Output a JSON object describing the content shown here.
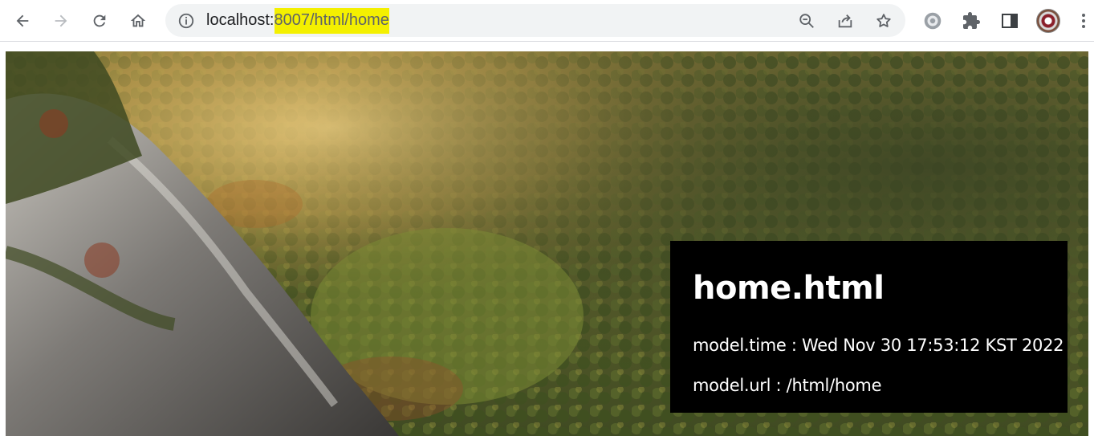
{
  "browser": {
    "url_host": "localhost:",
    "url_path_highlight": "8007/html/home",
    "icons": {
      "back": "back-arrow-icon",
      "forward": "forward-arrow-icon",
      "reload": "reload-icon",
      "home": "home-icon",
      "site_info": "info-icon",
      "zoom": "zoom-out-icon",
      "share": "share-icon",
      "bookmark": "star-icon",
      "extension_gear": "gear-icon",
      "extensions": "puzzle-icon",
      "side_panel": "side-panel-icon",
      "profile": "avatar",
      "menu": "kebab-menu-icon"
    },
    "highlight_color": "#f4f000"
  },
  "page": {
    "title": "home.html",
    "time_line": "model.time : Wed Nov 30 17:53:12 KST 2022",
    "url_line": "model.url : /html/home"
  }
}
